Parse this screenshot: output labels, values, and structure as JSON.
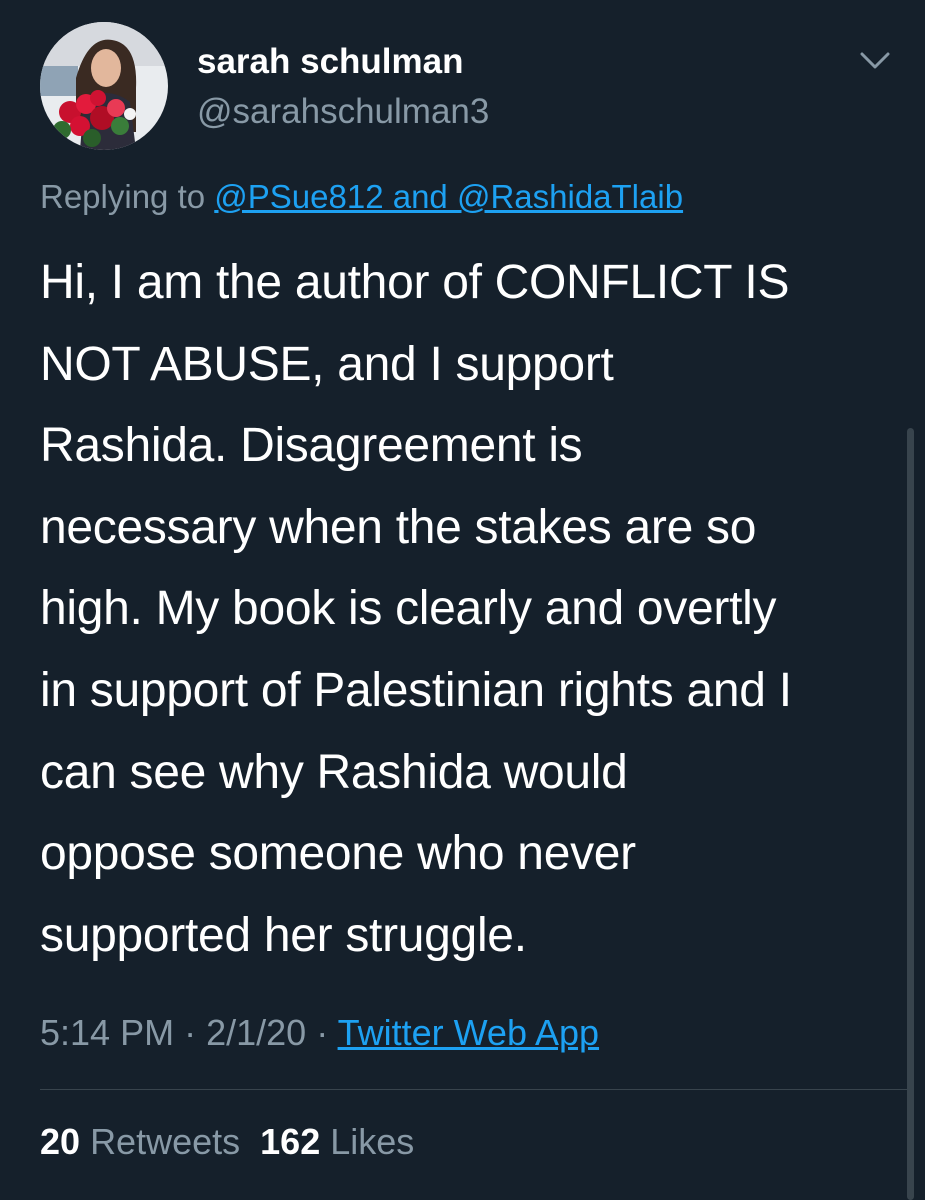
{
  "tweet": {
    "author": {
      "display_name": "sarah schulman",
      "handle": "@sarahschulman3"
    },
    "reply": {
      "prefix": "Replying to ",
      "mentions": "@PSue812 and @RashidaTlaib"
    },
    "text": "Hi, I am the author of CONFLICT IS\nNOT ABUSE, and I support\nRashida. Disagreement is\nnecessary when the stakes are so\nhigh. My book is clearly and overtly\nin support of Palestinian rights and I\ncan see why Rashida would\noppose someone who never\nsupported her struggle.",
    "time": "5:14 PM",
    "date": "2/1/20",
    "separator": "·",
    "source": "Twitter Web App",
    "stats": {
      "retweets_count": "20",
      "retweets_label": "Retweets",
      "likes_count": "162",
      "likes_label": "Likes"
    }
  },
  "icons": {
    "avatar": "avatar-photo",
    "menu": "chevron-down-icon"
  },
  "colors": {
    "background": "#15202b",
    "primary_text": "#ffffff",
    "secondary_text": "#8899a6",
    "link": "#1da1f2",
    "divider": "#38444d"
  }
}
